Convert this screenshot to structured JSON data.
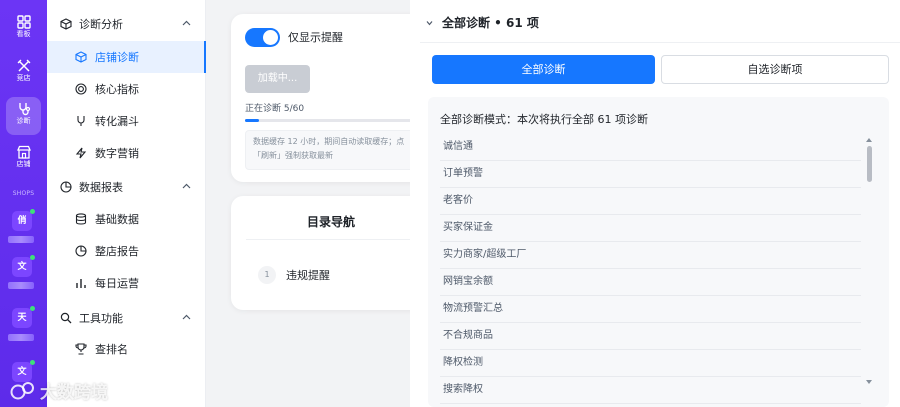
{
  "rail": {
    "items": [
      {
        "label": "看板",
        "icon": "dashboard-icon"
      },
      {
        "label": "竞店",
        "icon": "rival-icon"
      },
      {
        "label": "诊断",
        "icon": "stethoscope-icon"
      },
      {
        "label": "店铺",
        "icon": "store-icon"
      }
    ],
    "shops_label": "SHOPS",
    "shops": [
      "俏",
      "文",
      "天",
      "文"
    ]
  },
  "menu": {
    "group_diag": "诊断分析",
    "diag_items": [
      "店铺诊断",
      "核心指标",
      "转化漏斗",
      "数字营销"
    ],
    "group_report": "数据报表",
    "report_items": [
      "基础数据",
      "整店报告",
      "每日运营"
    ],
    "group_tools": "工具功能",
    "tool_items": [
      "查排名"
    ]
  },
  "control": {
    "toggle_label": "仅显示提醒",
    "toggle_on": true,
    "loading_button": "加载中...",
    "progress_text": "正在诊断 5/60",
    "progress_fraction": 0.0833,
    "hint": "数据缓存 12 小时，期间自动读取缓存；点「刷新」强制获取最新"
  },
  "toc": {
    "title": "目录导航",
    "items": [
      {
        "num": "1",
        "label": "违规提醒"
      }
    ]
  },
  "panel": {
    "header": "全部诊断 • 61 项",
    "tab_all": "全部诊断",
    "tab_custom": "自选诊断项",
    "mode_text": "全部诊断模式：本次将执行全部 61 项诊断",
    "items": [
      "诚信通",
      "订单预警",
      "老客价",
      "买家保证金",
      "实力商家/超级工厂",
      "网销宝余额",
      "物流预警汇总",
      "不合规商品",
      "降权检测",
      "搜索降权"
    ]
  },
  "watermark": "大数跨境",
  "colors": {
    "primary": "#1677ff",
    "rail": "#6b2ff2",
    "active_bg": "#e8f1ff"
  }
}
